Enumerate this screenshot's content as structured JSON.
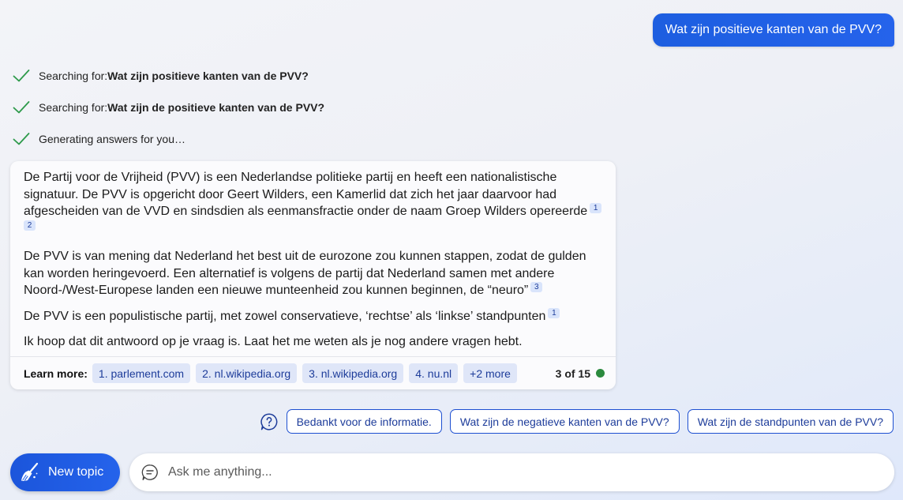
{
  "user_message": "Wat zijn positieve kanten van de PVV?",
  "status": [
    {
      "prefix": "Searching for: ",
      "query": "Wat zijn positieve kanten van de PVV?"
    },
    {
      "prefix": "Searching for: ",
      "query": "Wat zijn de positieve kanten van de PVV?"
    },
    {
      "prefix": "Generating answers for you…",
      "query": ""
    }
  ],
  "answer": {
    "p1": "De Partij voor de Vrijheid (PVV) is een Nederlandse politieke partij en heeft een nationalistische signatuur. De PVV is opgericht door Geert Wilders, een Kamerlid dat zich het jaar daarvoor had afgescheiden van de VVD en sindsdien als eenmansfractie onder de naam Groep Wilders opereerde",
    "p1_cites": [
      "1",
      "2"
    ],
    "p2": "De PVV is van mening dat Nederland het best uit de eurozone zou kunnen stappen, zodat de gulden kan worden heringevoerd. Een alternatief is volgens de partij dat Nederland samen met andere Noord-/West-Europese landen een nieuwe munteenheid zou kunnen beginnen, de “neuro”",
    "p2_cites": [
      "3"
    ],
    "p3": "De PVV is een populistische partij, met zowel conservatieve, ‘rechtse’ als ‘linkse’ standpunten",
    "p3_cites": [
      "1"
    ],
    "p4": "Ik hoop dat dit antwoord op je vraag is. Laat het me weten als je nog andere vragen hebt."
  },
  "learn_more": {
    "label": "Learn more:",
    "sources": [
      "1. parlement.com",
      "2. nl.wikipedia.org",
      "3. nl.wikipedia.org",
      "4. nu.nl",
      "+2 more"
    ],
    "counter": "3 of 15",
    "counter_color": "#2b8a3e"
  },
  "suggestions": [
    "Bedankt voor de informatie.",
    "Wat zijn de negatieve kanten van de PVV?",
    "Wat zijn de standpunten van de PVV?"
  ],
  "new_topic_label": "New topic",
  "ask": {
    "placeholder": "Ask me anything..."
  },
  "icons": {
    "status": "check-icon",
    "help": "question-bubble-icon",
    "new_topic": "broom-icon",
    "ask": "chat-bubble-icon"
  },
  "colors": {
    "accent": "#2563eb",
    "check": "#2e9a4b",
    "chip_bg": "#dfe6f8",
    "link": "#1d3c9a"
  }
}
